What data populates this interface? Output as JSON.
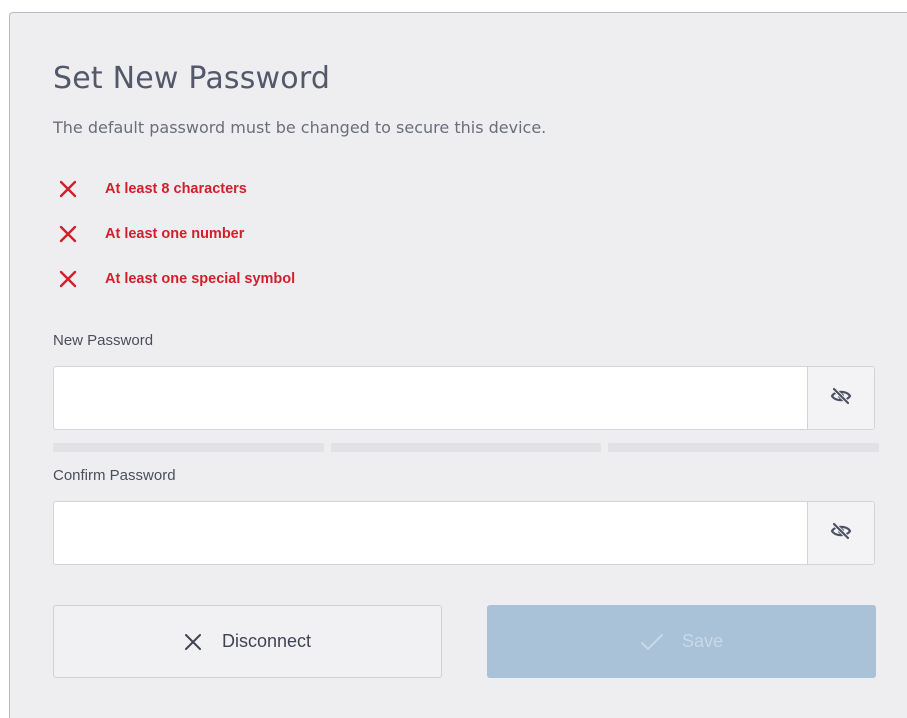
{
  "dialog": {
    "title": "Set New Password",
    "subtitle": "The default password must be changed to secure this device."
  },
  "requirements": [
    {
      "label": "At least 8 characters",
      "icon": "x-mark-icon",
      "status": "unmet"
    },
    {
      "label": "At least one number",
      "icon": "x-mark-icon",
      "status": "unmet"
    },
    {
      "label": "At least one special symbol",
      "icon": "x-mark-icon",
      "status": "unmet"
    }
  ],
  "new_password": {
    "label": "New Password",
    "value": "",
    "toggle_icon": "eye-slash-icon"
  },
  "strength_meter": {
    "segments": 3,
    "filled": 0
  },
  "confirm_password": {
    "label": "Confirm Password",
    "value": "",
    "toggle_icon": "eye-slash-icon"
  },
  "buttons": {
    "disconnect_label": "Disconnect",
    "disconnect_icon": "x-mark-icon",
    "save_label": "Save",
    "save_icon": "checkmark-icon",
    "save_enabled": false
  },
  "colors": {
    "error": "#d11f2b",
    "title": "#53586a",
    "save_disabled_bg": "#a9c2d8"
  }
}
